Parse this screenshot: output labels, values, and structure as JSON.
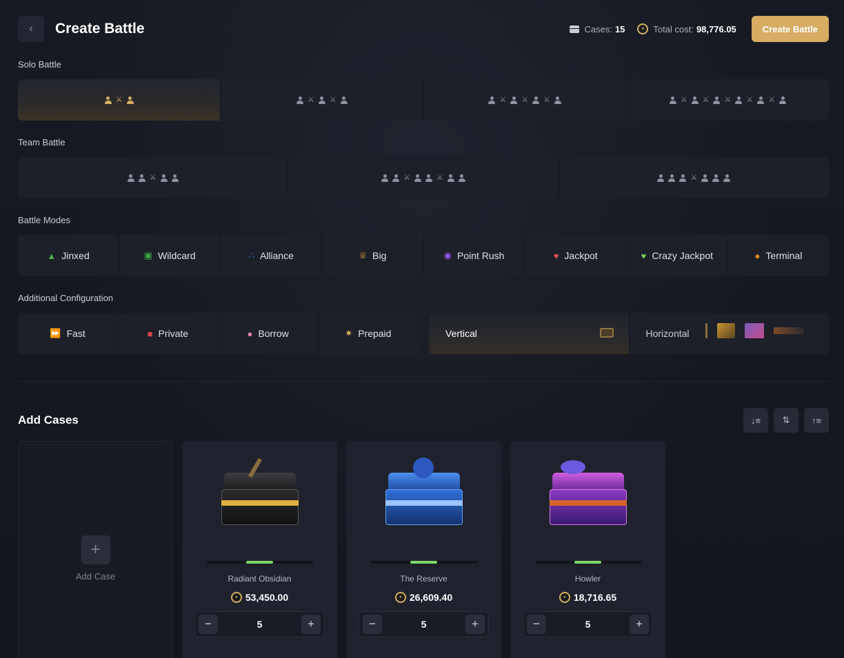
{
  "header": {
    "back_icon": "chevron-left-icon",
    "title": "Create Battle",
    "cases_label": "Cases:",
    "cases_count": "15",
    "total_cost_label": "Total cost:",
    "total_cost_value": "98,776.05",
    "create_button": "Create Battle"
  },
  "solo_battle": {
    "label": "Solo Battle",
    "options": [
      {
        "players": 2,
        "selected": true
      },
      {
        "players": 3,
        "selected": false
      },
      {
        "players": 4,
        "selected": false
      },
      {
        "players": 6,
        "selected": false
      }
    ]
  },
  "team_battle": {
    "label": "Team Battle",
    "options": [
      {
        "format": "2v2"
      },
      {
        "format": "2v2v2"
      },
      {
        "format": "3v3"
      }
    ]
  },
  "battle_modes": {
    "label": "Battle Modes",
    "items": [
      {
        "label": "Jinxed",
        "icon": "witch-hat-icon",
        "color": "#4caf50"
      },
      {
        "label": "Wildcard",
        "icon": "slot-icon",
        "color": "#3fa64a"
      },
      {
        "label": "Alliance",
        "icon": "alliance-icon",
        "color": "#3b82f6"
      },
      {
        "label": "Big",
        "icon": "crown-icon",
        "color": "#e0a53a"
      },
      {
        "label": "Point Rush",
        "icon": "target-icon",
        "color": "#8b5cf6"
      },
      {
        "label": "Jackpot",
        "icon": "jackpot-icon",
        "color": "#e05252"
      },
      {
        "label": "Crazy Jackpot",
        "icon": "crazy-jackpot-icon",
        "color": "#6fcf5b"
      },
      {
        "label": "Terminal",
        "icon": "flame-icon",
        "color": "#f08a24"
      }
    ]
  },
  "additional_config": {
    "label": "Additional Configuration",
    "options": [
      {
        "label": "Fast",
        "icon": "fast-forward-icon"
      },
      {
        "label": "Private",
        "icon": "lock-icon"
      },
      {
        "label": "Borrow",
        "icon": "piggy-bank-icon"
      },
      {
        "label": "Prepaid",
        "icon": "chip-icon"
      }
    ],
    "layout": [
      {
        "label": "Vertical",
        "selected": true
      },
      {
        "label": "Horizontal",
        "selected": false
      }
    ]
  },
  "cases": {
    "title": "Add Cases",
    "sort_buttons": [
      "sort-desc-icon",
      "shuffle-icon",
      "sort-asc-icon"
    ],
    "add_label": "Add Case",
    "items": [
      {
        "name": "Radiant Obsidian",
        "price": "53,450.00",
        "quantity": "5",
        "progress": 0.25,
        "accent": "#e0b040"
      },
      {
        "name": "The Reserve",
        "price": "26,609.40",
        "quantity": "5",
        "progress": 0.25,
        "accent": "#2f6fd6"
      },
      {
        "name": "Howler",
        "price": "18,716.65",
        "quantity": "5",
        "progress": 0.25,
        "accent": "#c04ad6"
      }
    ]
  },
  "colors": {
    "accent_gold": "#d6ad62",
    "progress_green": "#7fdc6a",
    "background": "#151820"
  }
}
